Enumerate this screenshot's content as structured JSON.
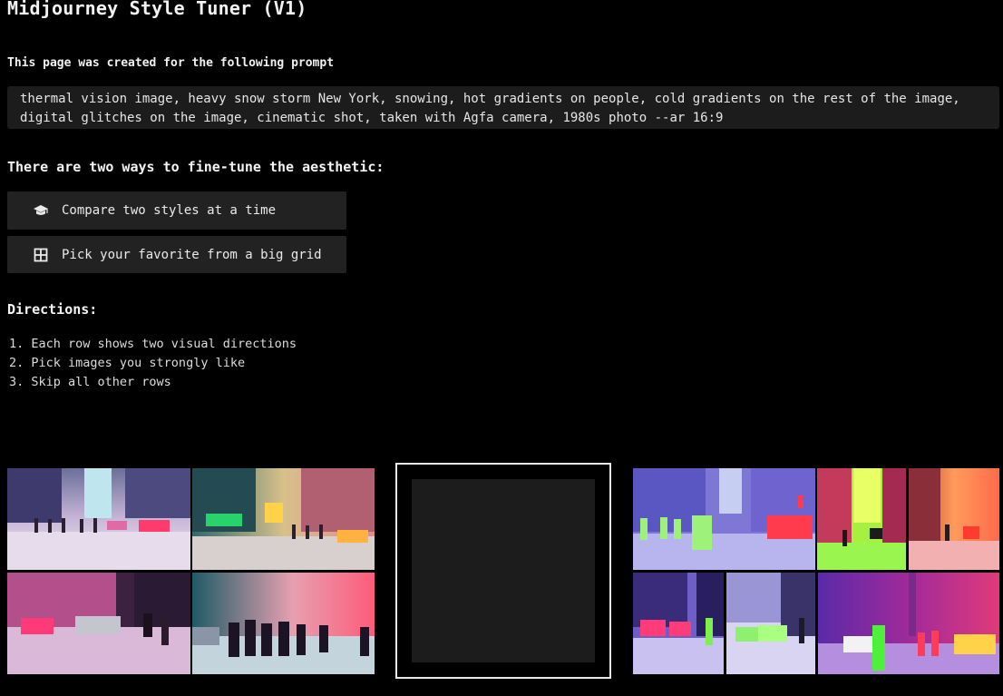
{
  "page": {
    "title": "Midjourney Style Tuner (V1)",
    "prompt_intro": "This page was created for the following prompt",
    "prompt_text": "thermal vision image, heavy snow storm New York, snowing, hot gradients on people, cold gradients on the rest of the image,\ndigital glitches on the image, cinematic shot, taken with Agfa camera, 1980s photo --ar 16:9"
  },
  "modes": {
    "heading": "There are two ways to fine-tune the aesthetic:",
    "compare": {
      "label": "Compare two styles at a time",
      "icon": "graduation-cap-icon"
    },
    "grid": {
      "label": "Pick your favorite from a big grid",
      "icon": "grid-icon"
    }
  },
  "directions": {
    "heading": "Directions:",
    "items": [
      "1. Each row shows two visual directions",
      "2. Pick images you strongly like",
      "3. Skip all other rows"
    ]
  },
  "colors": {
    "background": "#000000",
    "panel": "#1c1c1c",
    "button": "#222222",
    "frame": "#e8e8e8"
  }
}
